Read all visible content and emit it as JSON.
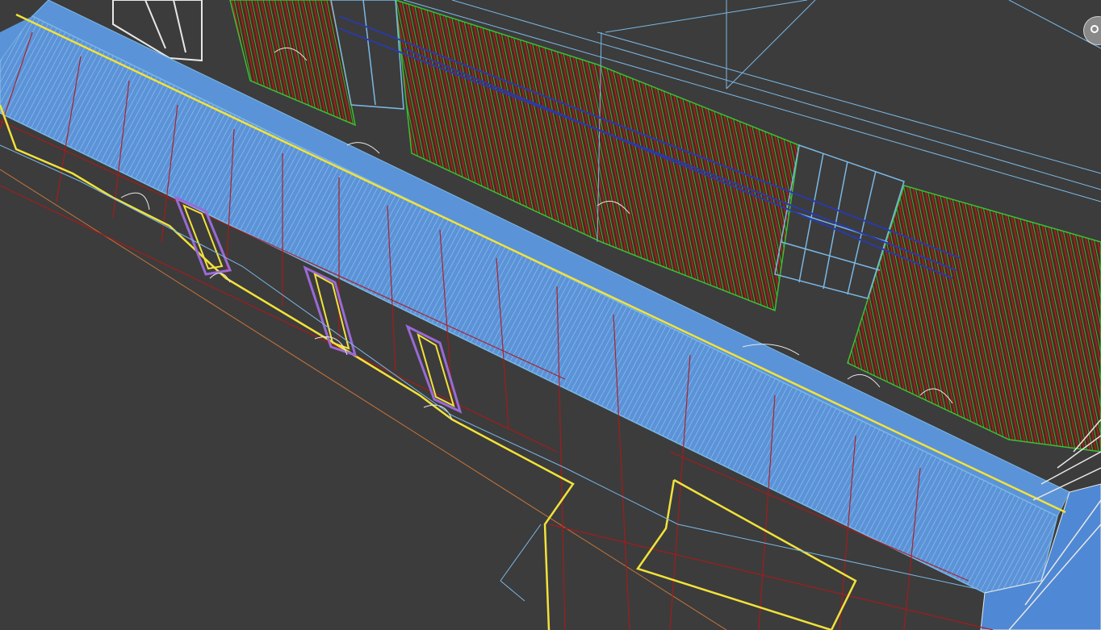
{
  "viewport": {
    "mode": "wireframe",
    "background_color": "#3c3c3c"
  },
  "colors": {
    "wall_fill": "#5b93d8",
    "wall_hatch": "#8fb8ea",
    "facade_red": "#b01818",
    "facade_green": "#36c236",
    "edge_yellow": "#f2e23a",
    "edge_white": "#e8e8e8",
    "edge_cyan": "#7ab8e6",
    "edge_blue": "#2a3aa8",
    "door_purple": "#9a6ad6",
    "ground_line": "#d07a3a"
  },
  "icons": {
    "navigation_gizmo": "viewcube-icon"
  }
}
